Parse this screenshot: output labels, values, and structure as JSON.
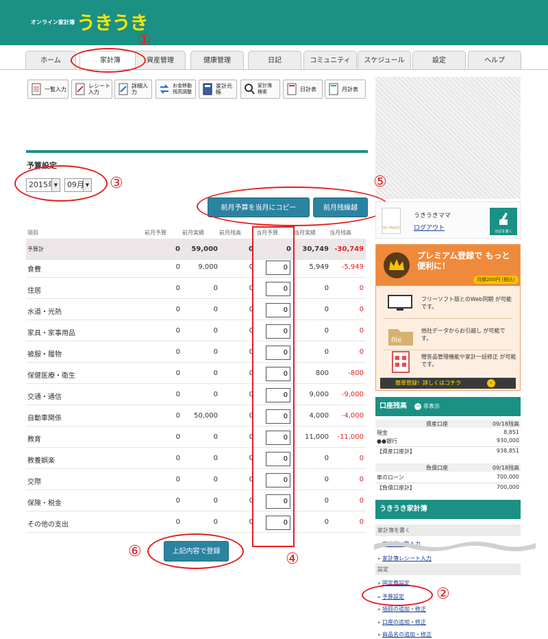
{
  "brand": {
    "sub": "オンライン家計簿",
    "main": "うきうき"
  },
  "tabs": [
    "ホーム",
    "家計簿",
    "資産管理",
    "健康管理",
    "日記",
    "コミュニティ",
    "スケジュール",
    "設定",
    "ヘルプ"
  ],
  "active_tab": "家計簿",
  "toolbar": [
    {
      "label": "一覧入力",
      "icon": "list-input-icon"
    },
    {
      "label": "レシート入力",
      "icon": "receipt-input-icon"
    },
    {
      "label": "詳細入力",
      "icon": "detail-input-icon"
    },
    {
      "label": "お金移動 残高調整",
      "icon": "transfer-icon"
    },
    {
      "label": "家計元帳",
      "icon": "ledger-icon"
    },
    {
      "label": "家計簿 検索",
      "icon": "search-icon"
    },
    {
      "label": "日計表",
      "icon": "daily-sheet-icon"
    },
    {
      "label": "月計表",
      "icon": "monthly-sheet-icon"
    }
  ],
  "budget": {
    "title": "予算設定",
    "year": "2015年",
    "month": "09月",
    "copy_button": "前月予算を当月にコピー",
    "carry_button": "前月残繰越",
    "submit_button": "上記内容で登録",
    "columns": [
      "項目",
      "前月予算",
      "前月実績",
      "前月残高",
      "当月予算",
      "当月実績",
      "当月残高"
    ],
    "total": {
      "name": "予算計",
      "prev_budget": "0",
      "prev_actual": "59,000",
      "prev_balance": "0",
      "cur_budget": "0",
      "cur_actual": "30,749",
      "cur_balance": "-30,749"
    },
    "rows": [
      {
        "name": "食費",
        "prev_budget": "0",
        "prev_actual": "9,000",
        "prev_balance": "0",
        "input": "0",
        "cur_actual": "5,949",
        "cur_balance": "-5,949"
      },
      {
        "name": "住居",
        "prev_budget": "0",
        "prev_actual": "0",
        "prev_balance": "0",
        "input": "0",
        "cur_actual": "0",
        "cur_balance": "0"
      },
      {
        "name": "水道・光熱",
        "prev_budget": "0",
        "prev_actual": "0",
        "prev_balance": "0",
        "input": "0",
        "cur_actual": "0",
        "cur_balance": "0"
      },
      {
        "name": "家具・家事用品",
        "prev_budget": "0",
        "prev_actual": "0",
        "prev_balance": "0",
        "input": "0",
        "cur_actual": "0",
        "cur_balance": "0"
      },
      {
        "name": "被服・履物",
        "prev_budget": "0",
        "prev_actual": "0",
        "prev_balance": "0",
        "input": "0",
        "cur_actual": "0",
        "cur_balance": "0"
      },
      {
        "name": "保健医療・衛生",
        "prev_budget": "0",
        "prev_actual": "0",
        "prev_balance": "0",
        "input": "0",
        "cur_actual": "800",
        "cur_balance": "-800"
      },
      {
        "name": "交通・通信",
        "prev_budget": "0",
        "prev_actual": "0",
        "prev_balance": "0",
        "input": "0",
        "cur_actual": "9,000",
        "cur_balance": "-9,000"
      },
      {
        "name": "自動車関係",
        "prev_budget": "0",
        "prev_actual": "50,000",
        "prev_balance": "0",
        "input": "0",
        "cur_actual": "4,000",
        "cur_balance": "-4,000"
      },
      {
        "name": "教育",
        "prev_budget": "0",
        "prev_actual": "0",
        "prev_balance": "0",
        "input": "0",
        "cur_actual": "11,000",
        "cur_balance": "-11,000"
      },
      {
        "name": "教養娯楽",
        "prev_budget": "0",
        "prev_actual": "0",
        "prev_balance": "0",
        "input": "0",
        "cur_actual": "0",
        "cur_balance": "0"
      },
      {
        "name": "交際",
        "prev_budget": "0",
        "prev_actual": "0",
        "prev_balance": "0",
        "input": "0",
        "cur_actual": "0",
        "cur_balance": "0"
      },
      {
        "name": "保険・税金",
        "prev_budget": "0",
        "prev_actual": "0",
        "prev_balance": "0",
        "input": "0",
        "cur_actual": "0",
        "cur_balance": "0"
      },
      {
        "name": "その他の支出",
        "prev_budget": "0",
        "prev_actual": "0",
        "prev_balance": "0",
        "input": "0",
        "cur_actual": "0",
        "cur_balance": "0"
      }
    ]
  },
  "annotations": [
    "①",
    "②",
    "③",
    "④",
    "⑤",
    "⑥"
  ],
  "user": {
    "name": "うきうきママ",
    "logout": "ログアウト",
    "diary_button": "日記を書く",
    "avatar_text": "NO IMAGE"
  },
  "premium": {
    "title": "プレミアム登録で もっと便利に！",
    "price": "月額200円 (税込)",
    "items": [
      "フリーソフト版とのWeb同期 が可能です。",
      "他社データからお引越し が可能です。",
      "贈答品管理機能や家計一括修正 が可能です。"
    ],
    "footer": "簡単登録！詳しくはコチラ"
  },
  "accounts": {
    "title": "口座残高",
    "hide": "非表示",
    "asset_header": "資産口座",
    "asset_date": "09/18残高",
    "assets": [
      {
        "name": "現金",
        "value": "8,851"
      },
      {
        "name": "●●銀行",
        "value": "930,000"
      }
    ],
    "asset_total": {
      "name": "【資産口座計】",
      "value": "938,851"
    },
    "debt_header": "負債口座",
    "debt_date": "09/18残高",
    "debts": [
      {
        "name": "車のローン",
        "value": "700,000"
      }
    ],
    "debt_total": {
      "name": "【負債口座計】",
      "value": "700,000"
    }
  },
  "sidebar": {
    "title": "うきうき家計簿",
    "group1": "家計簿を書く",
    "link1": "家計簿一覧入力",
    "link2": "家計簿レシート入力",
    "group2": "設定",
    "settings_links": [
      "固定費設定",
      "予算設定",
      "項目の追加・修正",
      "口座の追加・修正",
      "商品名の追加・修正"
    ]
  },
  "colors": {
    "teal": "#1a9184",
    "brand_yellow": "#ffe600",
    "button": "#2c83a0",
    "annotation": "#e41e1e",
    "negative": "#e02020"
  }
}
